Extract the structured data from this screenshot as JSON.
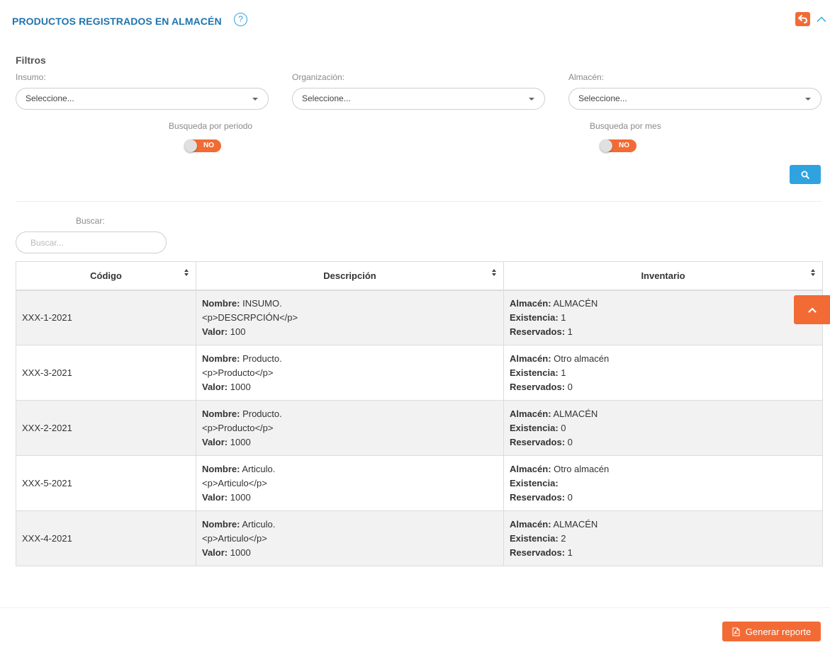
{
  "header": {
    "title": "PRODUCTOS REGISTRADOS EN ALMACÉN",
    "help_icon": "question-circle-icon",
    "back_icon": "reply-icon",
    "collapse_icon": "chevron-up-icon"
  },
  "filters": {
    "title": "Filtros",
    "insumo": {
      "label": "Insumo:",
      "value": "Seleccione..."
    },
    "organizacion": {
      "label": "Organización:",
      "value": "Seleccione..."
    },
    "almacen": {
      "label": "Almacén:",
      "value": "Seleccione..."
    },
    "periodo": {
      "label": "Busqueda por periodo",
      "state": "NO"
    },
    "mes": {
      "label": "Busqueda por mes",
      "state": "NO"
    },
    "search_icon": "search-icon"
  },
  "buscar": {
    "label": "Buscar:",
    "placeholder": "Buscar...",
    "value": ""
  },
  "table": {
    "columns": [
      "Código",
      "Descripción",
      "Inventario"
    ],
    "field_labels": {
      "nombre": "Nombre:",
      "valor": "Valor:",
      "almacen": "Almacén:",
      "existencia": "Existencia:",
      "reservados": "Reservados:"
    },
    "rows": [
      {
        "codigo": "XXX-1-2021",
        "nombre": "INSUMO.",
        "descripcion": "<p>DESCRPCIÓN</p>",
        "valor": "100",
        "almacen": "ALMACÉN",
        "existencia": "1",
        "reservados": "1"
      },
      {
        "codigo": "XXX-3-2021",
        "nombre": "Producto.",
        "descripcion": "<p>Producto</p>",
        "valor": "1000",
        "almacen": "Otro almacén",
        "existencia": "1",
        "reservados": "0"
      },
      {
        "codigo": "XXX-2-2021",
        "nombre": "Producto.",
        "descripcion": "<p>Producto</p>",
        "valor": "1000",
        "almacen": "ALMACÉN",
        "existencia": "0",
        "reservados": "0"
      },
      {
        "codigo": "XXX-5-2021",
        "nombre": "Articulo.",
        "descripcion": "<p>Articulo</p>",
        "valor": "1000",
        "almacen": "Otro almacén",
        "existencia": "",
        "reservados": "0"
      },
      {
        "codigo": "XXX-4-2021",
        "nombre": "Articulo.",
        "descripcion": "<p>Articulo</p>",
        "valor": "1000",
        "almacen": "ALMACÉN",
        "existencia": "2",
        "reservados": "1"
      }
    ]
  },
  "footer": {
    "report_label": "Generar reporte",
    "report_icon": "file-pdf-icon"
  },
  "colors": {
    "title": "#1f74b0",
    "accent_orange": "#f26b35",
    "accent_blue": "#2fa3e0"
  }
}
